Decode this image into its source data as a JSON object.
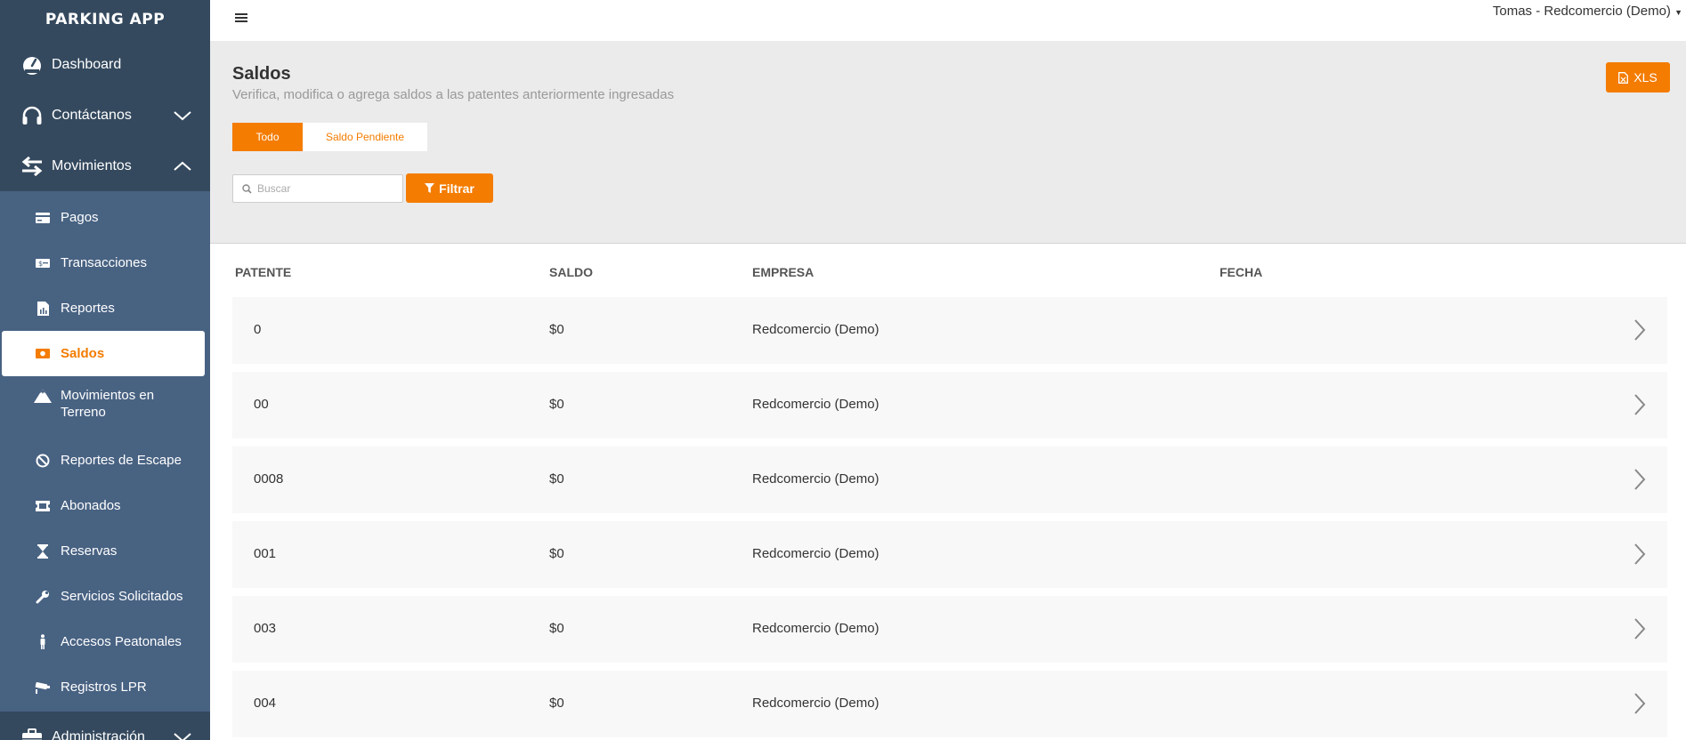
{
  "brand": "PARKING APP",
  "topbar": {
    "user": "Tomas - Redcomercio (Demo)"
  },
  "sidebar": {
    "top_items": [
      {
        "label": "Dashboard",
        "icon": "dashboard-icon"
      },
      {
        "label": "Contáctanos",
        "icon": "headphones-icon",
        "expanded": false
      },
      {
        "label": "Movimientos",
        "icon": "exchange-icon",
        "expanded": true
      }
    ],
    "sub_items": [
      {
        "label": "Pagos",
        "icon": "credit-card-icon"
      },
      {
        "label": "Transacciones",
        "icon": "money-icon"
      },
      {
        "label": "Reportes",
        "icon": "report-icon"
      },
      {
        "label": "Saldos",
        "icon": "cash-icon",
        "active": true
      },
      {
        "label": "Movimientos en Terreno",
        "icon": "mountain-icon"
      },
      {
        "label": "Reportes de Escape",
        "icon": "ban-icon"
      },
      {
        "label": "Abonados",
        "icon": "ticket-icon"
      },
      {
        "label": "Reservas",
        "icon": "hourglass-icon"
      },
      {
        "label": "Servicios Solicitados",
        "icon": "wrench-icon"
      },
      {
        "label": "Accesos Peatonales",
        "icon": "pedestrian-icon"
      },
      {
        "label": "Registros LPR",
        "icon": "camera-icon"
      }
    ],
    "bottom_item": {
      "label": "Administración",
      "icon": "briefcase-icon"
    }
  },
  "header": {
    "title": "Saldos",
    "subtitle": "Verifica, modifica o agrega saldos a las patentes anteriormente ingresadas",
    "xls_label": "XLS",
    "tabs": [
      {
        "label": "Todo",
        "active": true
      },
      {
        "label": "Saldo Pendiente",
        "active": false
      }
    ],
    "search_placeholder": "Buscar",
    "filter_label": "Filtrar"
  },
  "table": {
    "columns": [
      "PATENTE",
      "SALDO",
      "EMPRESA",
      "FECHA"
    ],
    "rows": [
      {
        "patente": "0",
        "saldo": "$0",
        "empresa": "Redcomercio (Demo)",
        "fecha": ""
      },
      {
        "patente": "00",
        "saldo": "$0",
        "empresa": "Redcomercio (Demo)",
        "fecha": ""
      },
      {
        "patente": "0008",
        "saldo": "$0",
        "empresa": "Redcomercio (Demo)",
        "fecha": ""
      },
      {
        "patente": "001",
        "saldo": "$0",
        "empresa": "Redcomercio (Demo)",
        "fecha": ""
      },
      {
        "patente": "003",
        "saldo": "$0",
        "empresa": "Redcomercio (Demo)",
        "fecha": ""
      },
      {
        "patente": "004",
        "saldo": "$0",
        "empresa": "Redcomercio (Demo)",
        "fecha": ""
      }
    ]
  },
  "colors": {
    "accent": "#f47c00",
    "sidebar": "#34495e",
    "submenu": "#486282",
    "header_bg": "#ebebeb"
  }
}
